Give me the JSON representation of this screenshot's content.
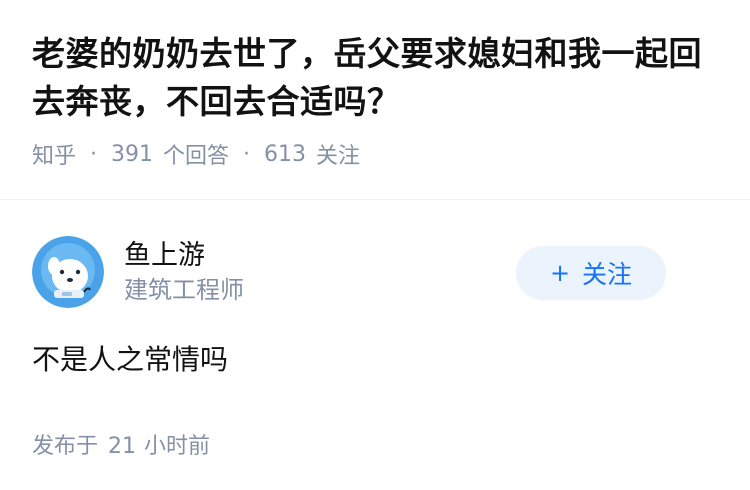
{
  "question": {
    "title": "老婆的奶奶去世了，岳父要求媳妇和我一起回去奔丧，不回去合适吗？",
    "source": "知乎",
    "separator": "·",
    "answers_count": "391",
    "answers_label": "个回答",
    "followers_count": "613",
    "followers_label": "关注"
  },
  "answer": {
    "author": {
      "name": "鱼上游",
      "headline": "建筑工程师",
      "avatar_icon": "cartoon-avatar-icon"
    },
    "follow_button": {
      "plus": "+",
      "label": "关注"
    },
    "content": "不是人之常情吗",
    "publish_prefix": "发布于",
    "publish_num": "21",
    "publish_unit": "小时前"
  },
  "colors": {
    "title": "#121212",
    "meta": "#8590a6",
    "accent": "#1772f6",
    "follow_bg": "#ebf3fd",
    "avatar_bg": "#4aa3e8"
  }
}
